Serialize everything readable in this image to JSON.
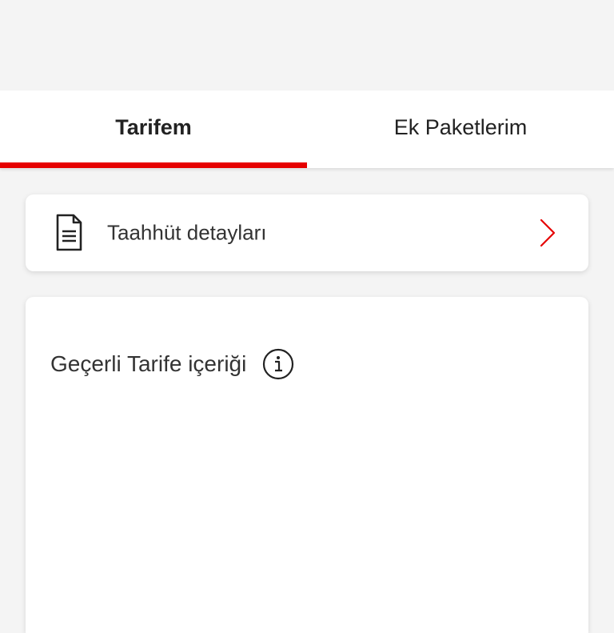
{
  "tabs": [
    {
      "label": "Tarifem",
      "active": true
    },
    {
      "label": "Ek Paketlerim",
      "active": false
    }
  ],
  "commitment_card": {
    "label": "Taahhüt detayları",
    "icon": "document-icon",
    "action_icon": "chevron-right-icon"
  },
  "tariff_card": {
    "title": "Geçerli Tarife içeriği",
    "icon": "info-icon"
  },
  "colors": {
    "accent": "#e60000",
    "background": "#f4f4f4",
    "card": "#ffffff",
    "text": "#333333"
  }
}
